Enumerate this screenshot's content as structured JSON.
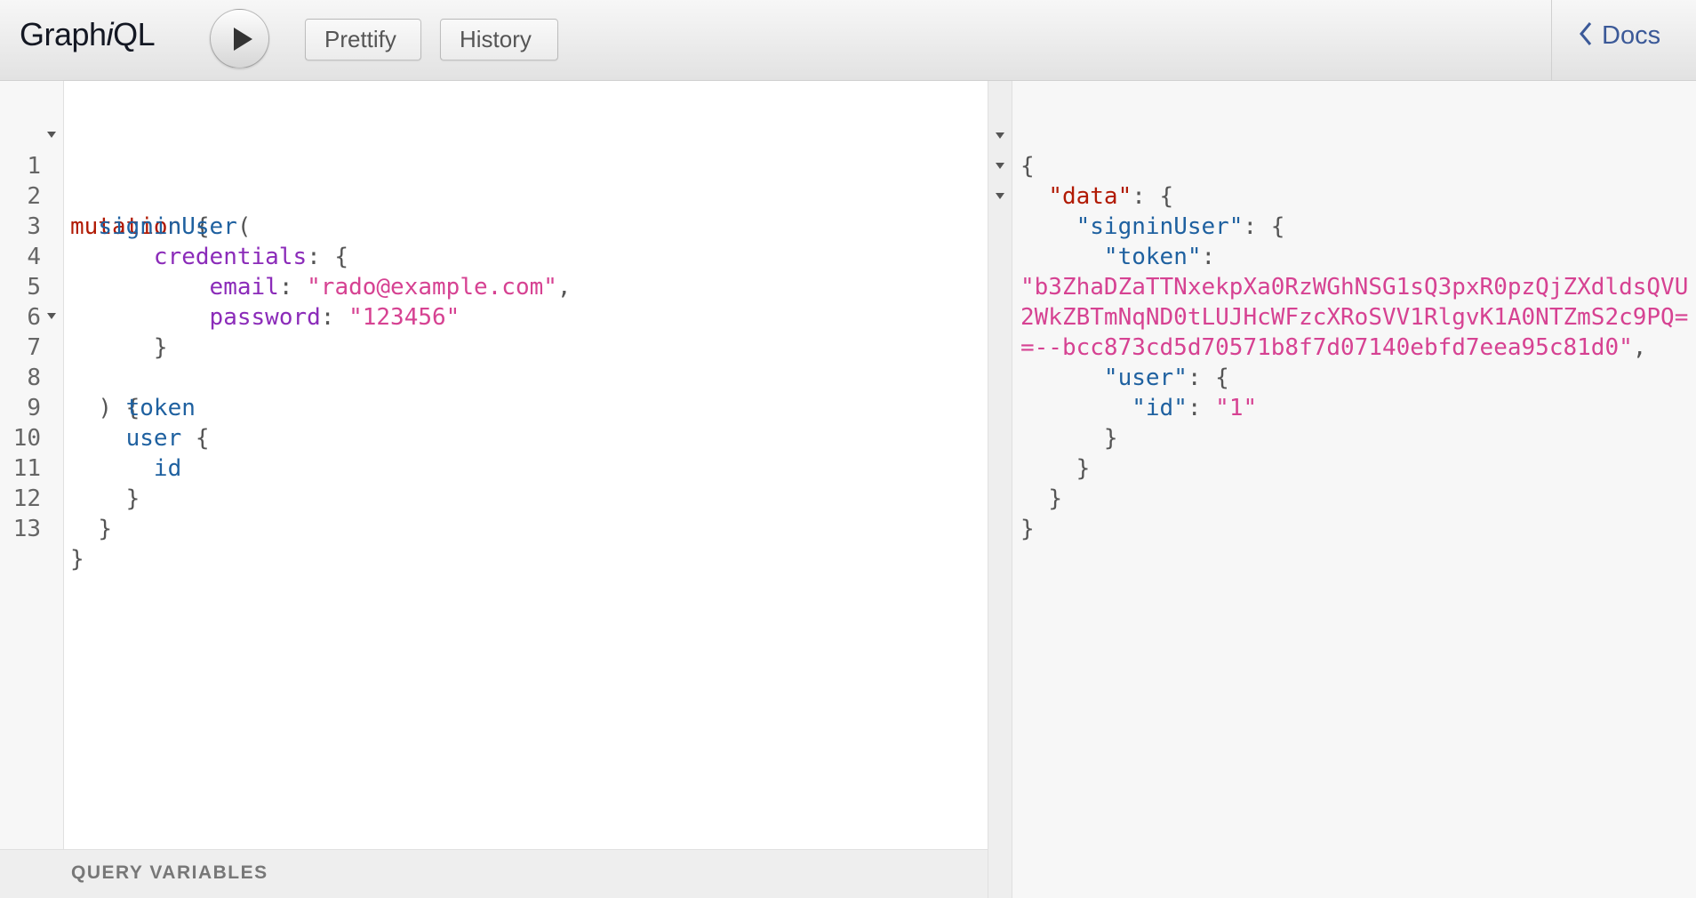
{
  "toolbar": {
    "logo_prefix": "Graph",
    "logo_italic": "i",
    "logo_suffix": "QL",
    "run_button": "play-icon",
    "prettify_label": "Prettify",
    "history_label": "History",
    "docs_label": "Docs"
  },
  "query_editor": {
    "line_numbers": [
      "1",
      "2",
      "3",
      "4",
      "5",
      "6",
      "7",
      "8",
      "9",
      "10",
      "11",
      "12",
      "13"
    ],
    "lines": [
      [
        "mutation",
        " {"
      ],
      [
        "  ",
        "signinUser",
        "("
      ],
      [
        "      ",
        "credentials",
        ": {"
      ],
      [
        "          ",
        "email",
        ": ",
        "\"rado@example.com\"",
        ","
      ],
      [
        "          ",
        "password",
        ": ",
        "\"123456\""
      ],
      [
        "      ",
        "}"
      ],
      [
        "  ",
        ") {"
      ],
      [
        "    ",
        "token"
      ],
      [
        "    ",
        "user",
        " {"
      ],
      [
        "      ",
        "id"
      ],
      [
        "    ",
        "}"
      ],
      [
        "  ",
        "}"
      ],
      [
        "}"
      ]
    ]
  },
  "query_variables_label": "QUERY VARIABLES",
  "result": {
    "lines": [
      [
        "{"
      ],
      [
        "  ",
        "\"data\"",
        ": {"
      ],
      [
        "    ",
        "\"signinUser\"",
        ": {"
      ],
      [
        "      ",
        "\"token\"",
        ":"
      ],
      [
        "\"b3ZhaDZaTTNxekpXa0RzWGhNSG1sQ3pxR0pzQjZXdldsQVU"
      ],
      [
        "2WkZBTmNqND0tLUJHcWFzcXRoSVV1RlgvK1A0NTZmS2c9PQ="
      ],
      [
        "=--bcc873cd5d70571b8f7d07140ebfd7eea95c81d0\"",
        ","
      ],
      [
        "      ",
        "\"user\"",
        ": {"
      ],
      [
        "        ",
        "\"id\"",
        ": ",
        "\"1\""
      ],
      [
        "      ",
        "}"
      ],
      [
        "    ",
        "}"
      ],
      [
        "  ",
        "}"
      ],
      [
        "}"
      ]
    ]
  },
  "colors": {
    "keyword": "#b11a04",
    "field": "#1f61a0",
    "argument": "#8b2bb9",
    "string": "#d64292",
    "docs_link": "#3b5998"
  }
}
